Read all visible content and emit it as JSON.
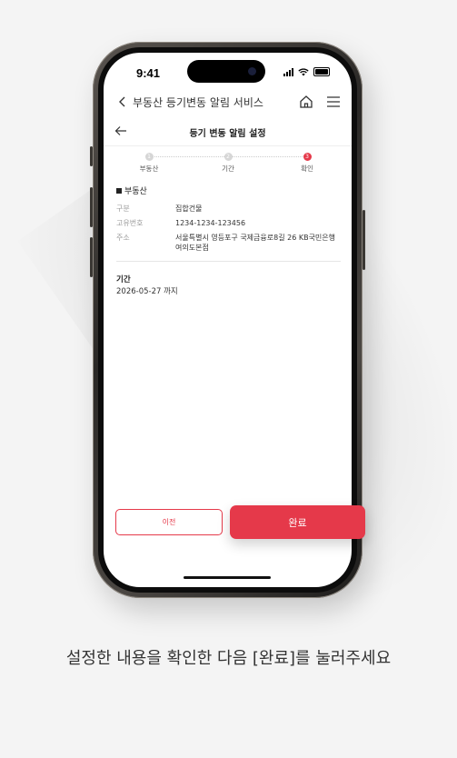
{
  "status_bar": {
    "time": "9:41"
  },
  "app_bar": {
    "title": "부동산 등기변동 알림 서비스"
  },
  "page": {
    "title": "등기 변동 알림 설정"
  },
  "steps": [
    {
      "num": "1",
      "label": "부동산",
      "active": false
    },
    {
      "num": "2",
      "label": "기간",
      "active": false
    },
    {
      "num": "3",
      "label": "확인",
      "active": true
    }
  ],
  "property": {
    "heading": "부동산",
    "rows": [
      {
        "key": "구분",
        "value": "집합건물"
      },
      {
        "key": "고유번호",
        "value": "1234-1234-123456"
      },
      {
        "key": "주소",
        "value": "서울특별시 영등포구 국제금융로8길 26 KB국민은행 여의도본점"
      }
    ]
  },
  "period": {
    "label": "기간",
    "value": "2026-05-27 까지"
  },
  "buttons": {
    "prev": "이전",
    "done": "완료"
  },
  "caption": "설정한 내용을 확인한 다음 [완료]를 눌러주세요",
  "colors": {
    "accent": "#e5394a"
  }
}
